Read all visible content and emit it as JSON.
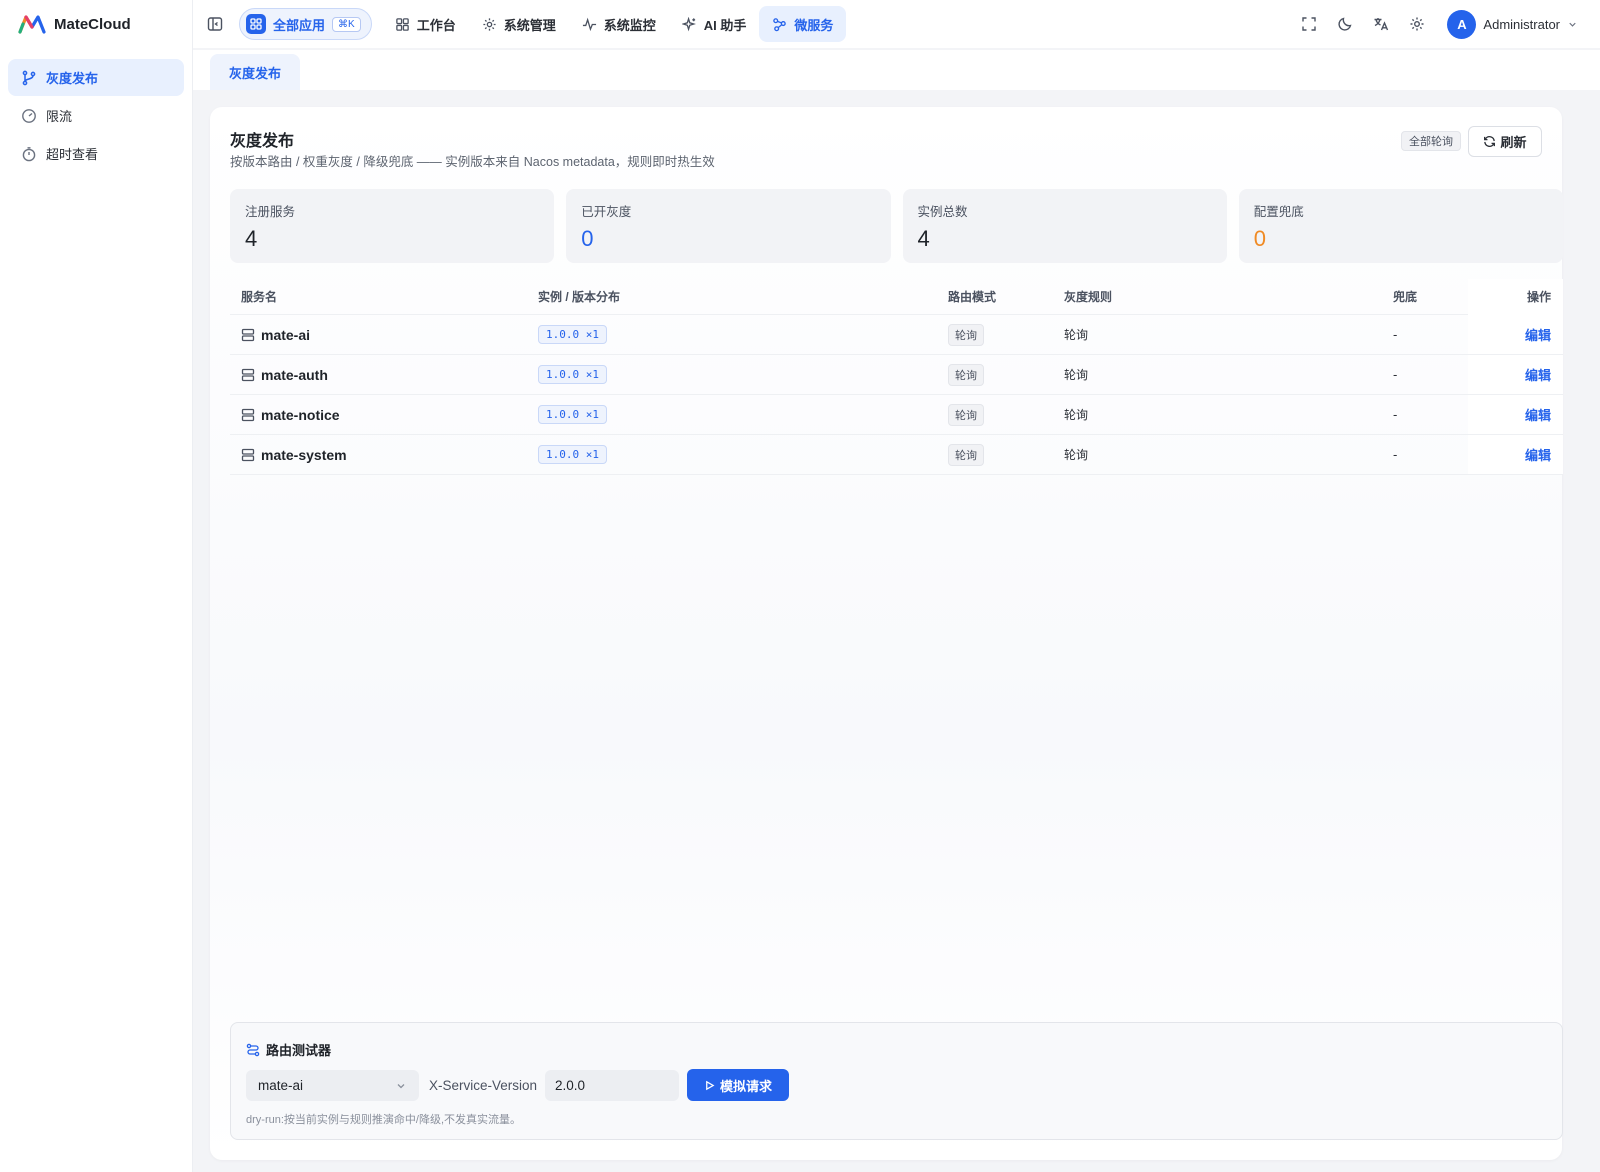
{
  "brand": {
    "name": "MateCloud"
  },
  "sidebar": {
    "items": [
      {
        "label": "灰度发布",
        "icon": "branch-icon",
        "active": true
      },
      {
        "label": "限流",
        "icon": "gauge-icon",
        "active": false
      },
      {
        "label": "超时查看",
        "icon": "timer-icon",
        "active": false
      }
    ]
  },
  "header": {
    "all_apps": {
      "label": "全部应用",
      "shortcut": "⌘K"
    },
    "nav": [
      {
        "label": "工作台",
        "icon": "grid-icon"
      },
      {
        "label": "系统管理",
        "icon": "gear-icon"
      },
      {
        "label": "系统监控",
        "icon": "pulse-icon"
      },
      {
        "label": "AI 助手",
        "icon": "sparkle-icon"
      },
      {
        "label": "微服务",
        "icon": "network-icon",
        "active": true
      }
    ],
    "user": {
      "avatar_letter": "A",
      "name": "Administrator"
    }
  },
  "tabs": [
    {
      "label": "灰度发布"
    }
  ],
  "page": {
    "title": "灰度发布",
    "subtitle": "按版本路由 / 权重灰度 / 降级兜底 —— 实例版本来自 Nacos metadata，规则即时热生效",
    "mode_badge": "全部轮询",
    "refresh_label": "刷新"
  },
  "stats": [
    {
      "label": "注册服务",
      "value": "4",
      "color": "default"
    },
    {
      "label": "已开灰度",
      "value": "0",
      "color": "blue"
    },
    {
      "label": "实例总数",
      "value": "4",
      "color": "default"
    },
    {
      "label": "配置兜底",
      "value": "0",
      "color": "orange"
    }
  ],
  "table": {
    "columns": [
      "服务名",
      "实例 / 版本分布",
      "路由模式",
      "灰度规则",
      "兜底",
      "操作"
    ],
    "rows": [
      {
        "name": "mate-ai",
        "version": "1.0.0 ×1",
        "mode": "轮询",
        "rule": "轮询",
        "fallback": "-",
        "action": "编辑"
      },
      {
        "name": "mate-auth",
        "version": "1.0.0 ×1",
        "mode": "轮询",
        "rule": "轮询",
        "fallback": "-",
        "action": "编辑"
      },
      {
        "name": "mate-notice",
        "version": "1.0.0 ×1",
        "mode": "轮询",
        "rule": "轮询",
        "fallback": "-",
        "action": "编辑"
      },
      {
        "name": "mate-system",
        "version": "1.0.0 ×1",
        "mode": "轮询",
        "rule": "轮询",
        "fallback": "-",
        "action": "编辑"
      }
    ]
  },
  "tester": {
    "title": "路由测试器",
    "service_selected": "mate-ai",
    "header_label": "X-Service-Version",
    "version_value": "2.0.0",
    "simulate_label": "模拟请求",
    "hint": "dry-run:按当前实例与规则推演命中/降级,不发真实流量。"
  },
  "colors": {
    "accent": "#2563eb",
    "orange": "#f08a24"
  }
}
